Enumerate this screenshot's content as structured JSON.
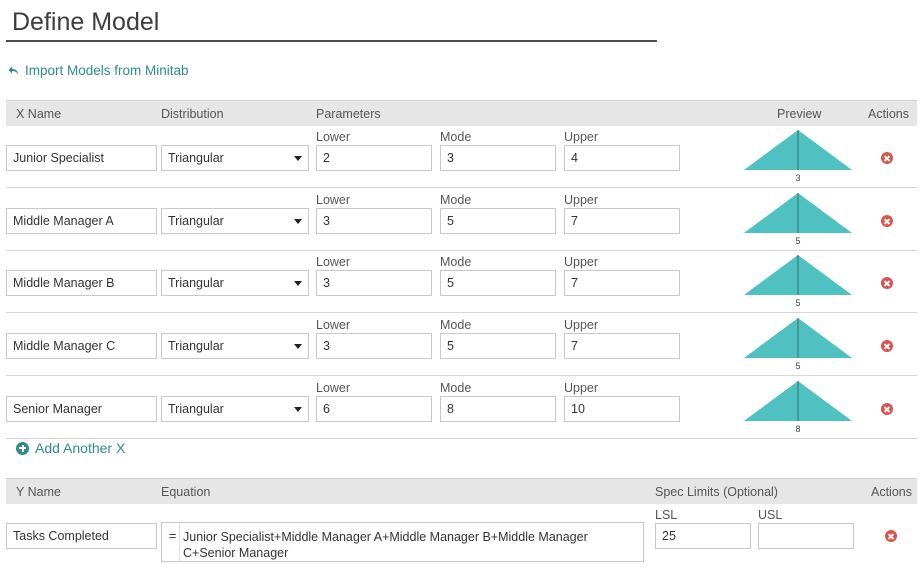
{
  "page": {
    "title": "Define Model",
    "import_link": "Import Models from Minitab",
    "add_link": "Add Another X"
  },
  "x_table": {
    "headers": {
      "name": "X Name",
      "distribution": "Distribution",
      "parameters": "Parameters",
      "preview": "Preview",
      "actions": "Actions"
    },
    "param_labels": {
      "lower": "Lower",
      "mode": "Mode",
      "upper": "Upper"
    },
    "rows": [
      {
        "name": "Junior Specialist",
        "distribution": "Triangular",
        "lower": "2",
        "mode": "3",
        "upper": "4",
        "preview_label": "3"
      },
      {
        "name": "Middle Manager A",
        "distribution": "Triangular",
        "lower": "3",
        "mode": "5",
        "upper": "7",
        "preview_label": "5"
      },
      {
        "name": "Middle Manager B",
        "distribution": "Triangular",
        "lower": "3",
        "mode": "5",
        "upper": "7",
        "preview_label": "5"
      },
      {
        "name": "Middle Manager C",
        "distribution": "Triangular",
        "lower": "3",
        "mode": "5",
        "upper": "7",
        "preview_label": "5"
      },
      {
        "name": "Senior Manager",
        "distribution": "Triangular",
        "lower": "6",
        "mode": "8",
        "upper": "10",
        "preview_label": "8"
      }
    ]
  },
  "y_table": {
    "headers": {
      "name": "Y Name",
      "equation": "Equation",
      "spec_limits": "Spec Limits (Optional)",
      "actions": "Actions"
    },
    "lsl_label": "LSL",
    "usl_label": "USL",
    "row": {
      "name": "Tasks Completed",
      "equals": "=",
      "equation": "Junior Specialist+Middle Manager A+Middle Manager B+Middle Manager C+Senior Manager",
      "lsl": "25",
      "usl": ""
    }
  },
  "colors": {
    "accent": "#2f8b8d",
    "preview_fill": "#4fc1c0",
    "remove": "#d9534f",
    "header_bg": "#e6e6e6"
  },
  "icons": {
    "import": "undo-arrow-icon",
    "add": "plus-circle-icon",
    "remove": "remove-circle-icon",
    "dropdown": "caret-down-icon"
  }
}
